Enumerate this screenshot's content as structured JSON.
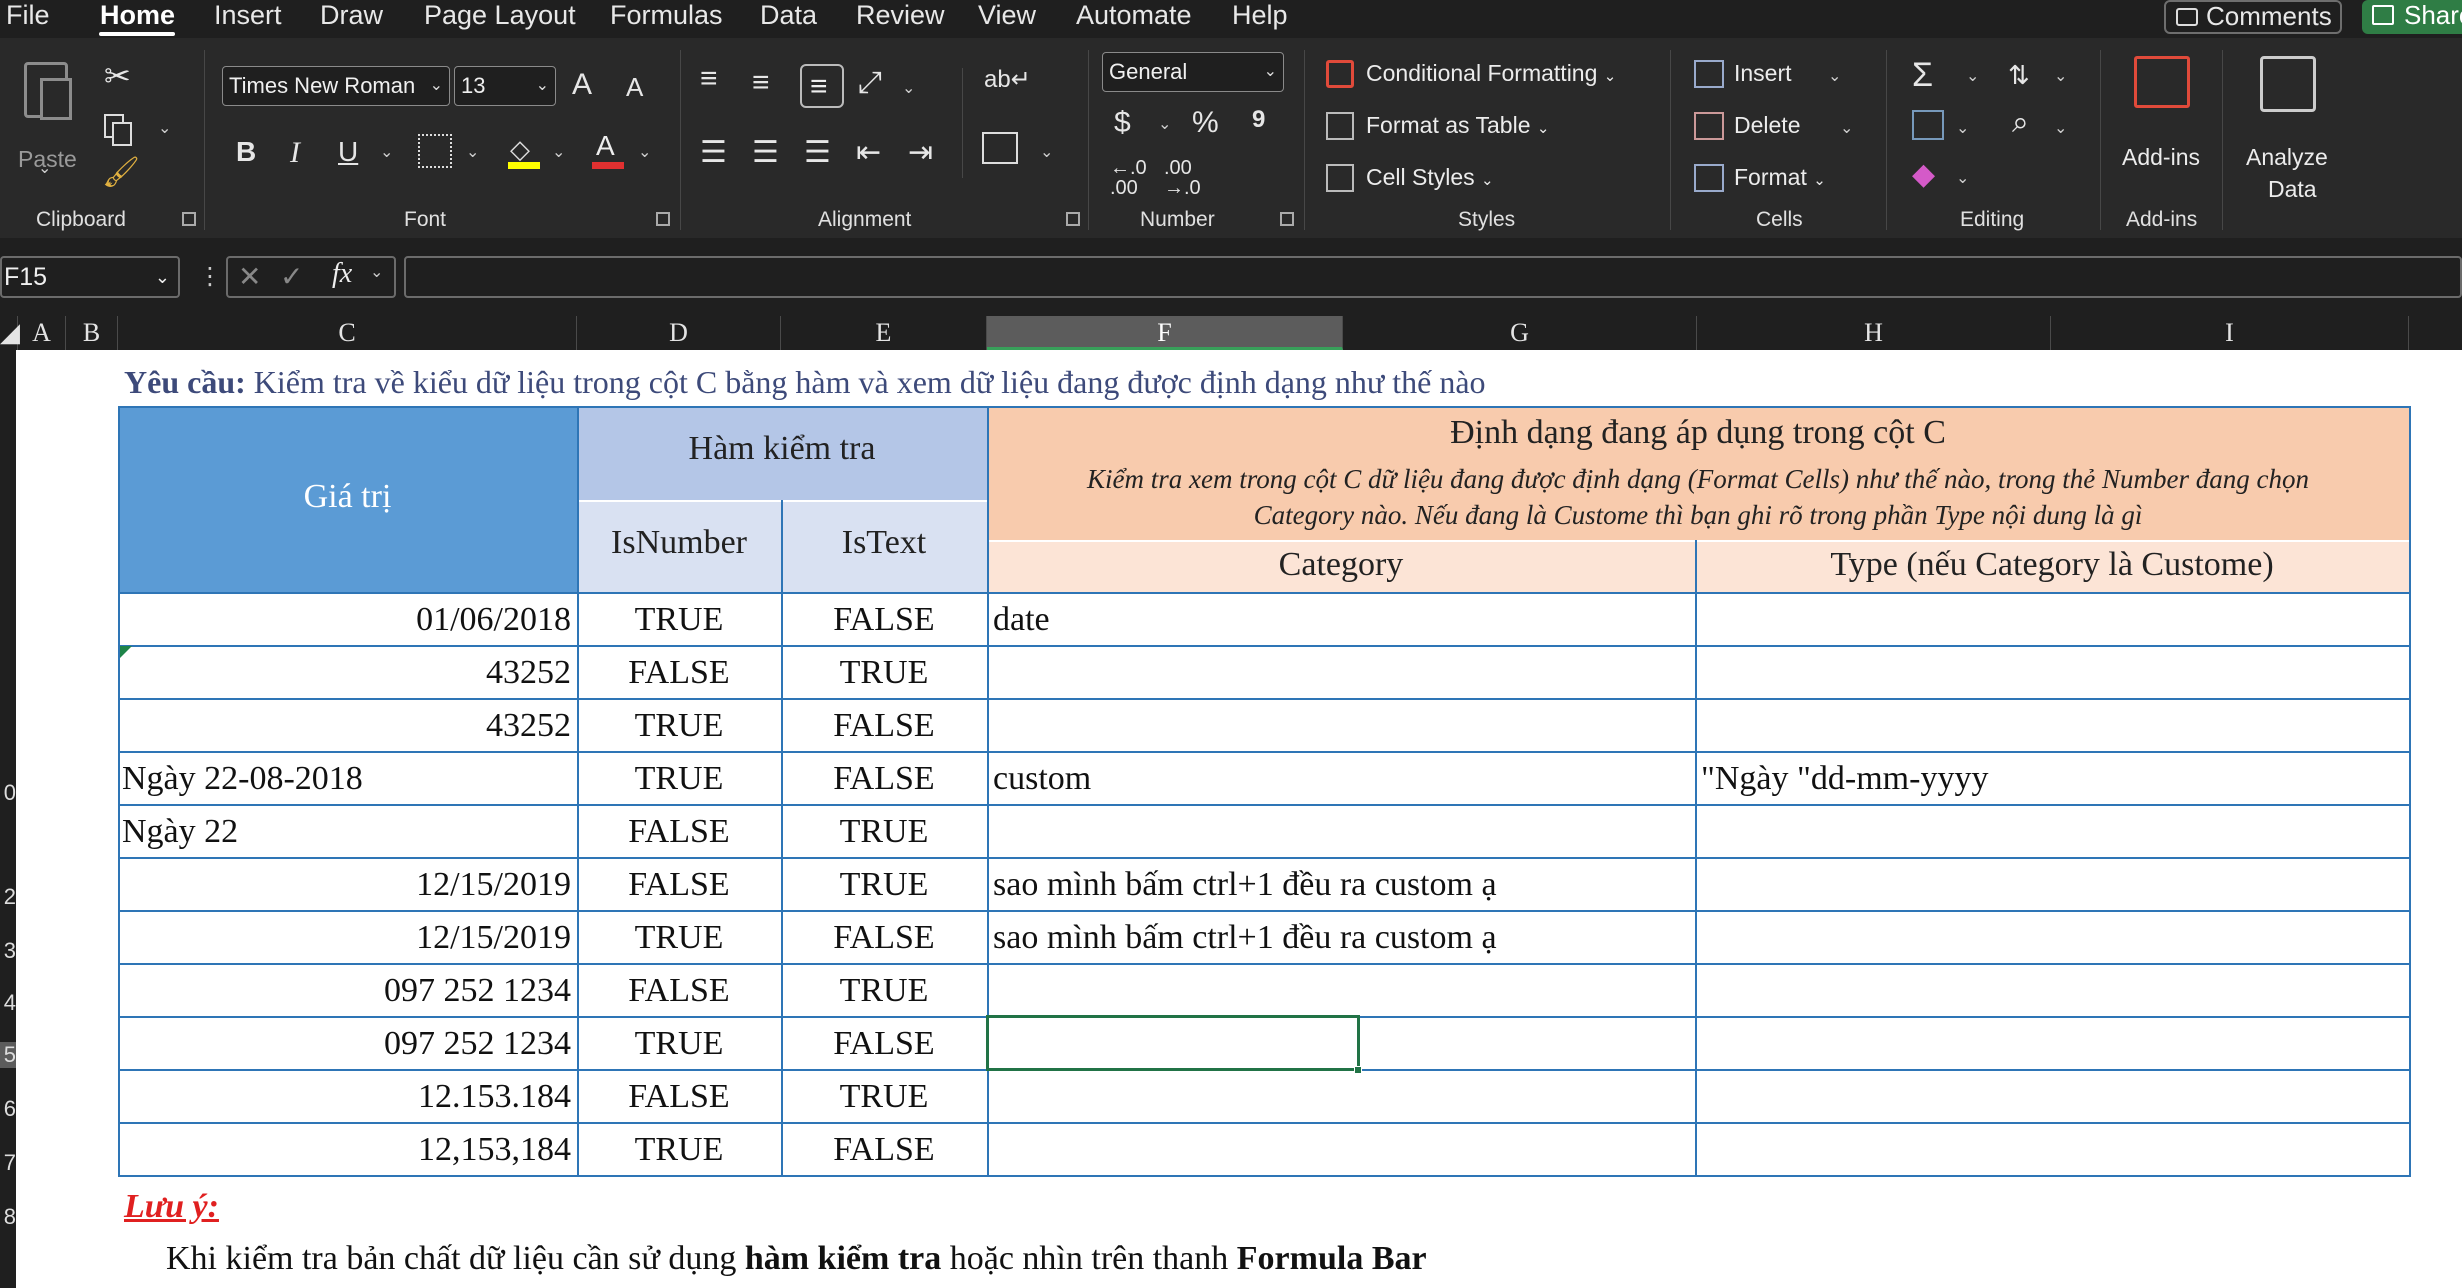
{
  "menu": {
    "items": [
      "File",
      "Home",
      "Insert",
      "Draw",
      "Page Layout",
      "Formulas",
      "Data",
      "Review",
      "View",
      "Automate",
      "Help"
    ],
    "comments": "Comments",
    "share": "Share"
  },
  "ribbon": {
    "clipboard": {
      "paste": "Paste",
      "label": "Clipboard"
    },
    "font": {
      "name": "Times New Roman",
      "size": "13",
      "bold": "B",
      "italic": "I",
      "underline": "U",
      "grow": "A",
      "shrink": "A",
      "label": "Font"
    },
    "alignment": {
      "label": "Alignment"
    },
    "number": {
      "format": "General",
      "currency": "$",
      "percent": "%",
      "comma": "9",
      "label": "Number"
    },
    "styles": {
      "conditional": "Conditional Formatting",
      "format_table": "Format as Table",
      "cell_styles": "Cell Styles",
      "label": "Styles"
    },
    "cells": {
      "insert": "Insert",
      "delete": "Delete",
      "format": "Format",
      "label": "Cells"
    },
    "editing": {
      "label": "Editing"
    },
    "addins": {
      "addins": "Add-ins",
      "analyze_1": "Analyze",
      "analyze_2": "Data",
      "label": "Add-ins"
    }
  },
  "formula_bar": {
    "name_box": "F15",
    "fx": "fx",
    "value": ""
  },
  "columns": [
    "A",
    "B",
    "C",
    "D",
    "E",
    "F",
    "G",
    "H",
    "I"
  ],
  "row_numbers": [
    "",
    "",
    "",
    "",
    "",
    "",
    "",
    "",
    "0",
    "",
    "2",
    "3",
    "4",
    "5",
    "6",
    "7",
    "8"
  ],
  "sheet": {
    "requirement_bold": "Yêu cầu:",
    "requirement_text": " Kiểm tra về kiểu dữ liệu trong cột C bằng hàm và xem dữ liệu đang được định dạng như thế nào",
    "header": {
      "gia_tri": "Giá trị",
      "ham_kiem_tra": "Hàm kiểm tra",
      "isnumber": "IsNumber",
      "istext": "IsText",
      "dinh_dang": "Định dạng đang áp dụng trong cột C",
      "note_line1": "Kiểm tra xem trong cột C dữ liệu đang được định dạng (Format Cells) như thế nào, trong thẻ Number đang chọn",
      "note_line2": "Category nào. Nếu đang là Custome thì bạn ghi rõ trong phần Type nội dung là gì",
      "category": "Category",
      "type": "Type (nếu Category là Custome)"
    },
    "rows": [
      {
        "value": "01/06/2018",
        "align": "right",
        "isnumber": "TRUE",
        "istext": "FALSE",
        "category": "date",
        "type": ""
      },
      {
        "value": "43252",
        "align": "right",
        "isnumber": "FALSE",
        "istext": "TRUE",
        "category": "",
        "type": ""
      },
      {
        "value": "43252",
        "align": "right",
        "isnumber": "TRUE",
        "istext": "FALSE",
        "category": "",
        "type": ""
      },
      {
        "value": "Ngày 22-08-2018",
        "align": "left",
        "isnumber": "TRUE",
        "istext": "FALSE",
        "category": "custom",
        "type": "\"Ngày \"dd-mm-yyyy"
      },
      {
        "value": "Ngày 22",
        "align": "left",
        "isnumber": "FALSE",
        "istext": "TRUE",
        "category": "",
        "type": ""
      },
      {
        "value": "12/15/2019",
        "align": "right",
        "isnumber": "FALSE",
        "istext": "TRUE",
        "category": "sao mình bấm ctrl+1 đều ra custom ạ",
        "type": ""
      },
      {
        "value": "12/15/2019",
        "align": "right",
        "isnumber": "TRUE",
        "istext": "FALSE",
        "category": "sao mình bấm ctrl+1 đều ra custom ạ",
        "type": ""
      },
      {
        "value": "097 252 1234",
        "align": "right",
        "isnumber": "FALSE",
        "istext": "TRUE",
        "category": "",
        "type": ""
      },
      {
        "value": "097 252 1234",
        "align": "right",
        "isnumber": "TRUE",
        "istext": "FALSE",
        "category": "",
        "type": ""
      },
      {
        "value": "12.153.184",
        "align": "right",
        "isnumber": "FALSE",
        "istext": "TRUE",
        "category": "",
        "type": ""
      },
      {
        "value": "12,153,184",
        "align": "right",
        "isnumber": "TRUE",
        "istext": "FALSE",
        "category": "",
        "type": ""
      }
    ],
    "note_title": "Lưu ý:",
    "note_text_1": "Khi kiểm tra bản chất dữ liệu cần sử dụng ",
    "note_bold_1": "hàm kiểm tra",
    "note_text_2": " hoặc nhìn trên thanh ",
    "note_bold_2": "Formula Bar"
  },
  "colors": {
    "header_blue": "#5b9bd5",
    "header_light_blue": "#b4c6e7",
    "header_light_blue2": "#d9e1f2",
    "header_peach": "#f8cbad",
    "header_light_peach": "#fce4d6",
    "border_blue": "#2e75b6",
    "share_green": "#2f7d45",
    "selection_green": "#217346"
  }
}
